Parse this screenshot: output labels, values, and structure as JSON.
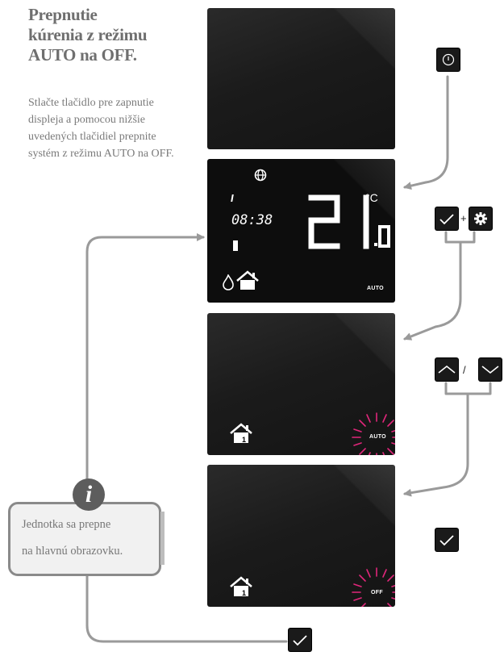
{
  "title_lines": [
    "Prepnutie",
    "kúrenia z režimu",
    "AUTO na OFF."
  ],
  "description_lines": [
    "Stlačte tlačidlo pre zapnutie",
    "displeja a pomocou nižšie",
    "uvedených tlačidiel prepnite",
    "systém z režimu AUTO na OFF."
  ],
  "screen2": {
    "clock": "08:38",
    "temp_whole": "21",
    "temp_decimal": ".0",
    "unit": "°C",
    "mode": "AUTO"
  },
  "screen3": {
    "mode": "AUTO"
  },
  "screen4": {
    "mode": "OFF"
  },
  "buttons": {
    "step1": [
      "power-icon"
    ],
    "step2": [
      "check-icon",
      "gear-icon"
    ],
    "step2_separator": "+",
    "step3": [
      "chevron-up-icon",
      "chevron-down-icon"
    ],
    "step3_separator": "/",
    "step4": [
      "check-icon"
    ],
    "return": [
      "check-icon"
    ]
  },
  "info": {
    "icon": "i",
    "lines": [
      "Jednotka sa prepne",
      "na hlavnú obrazovku."
    ]
  },
  "colors": {
    "accent_flash": "#e0267a",
    "arrow_gray": "#9a9a9a",
    "screen_bg": "#1a1a1a"
  }
}
